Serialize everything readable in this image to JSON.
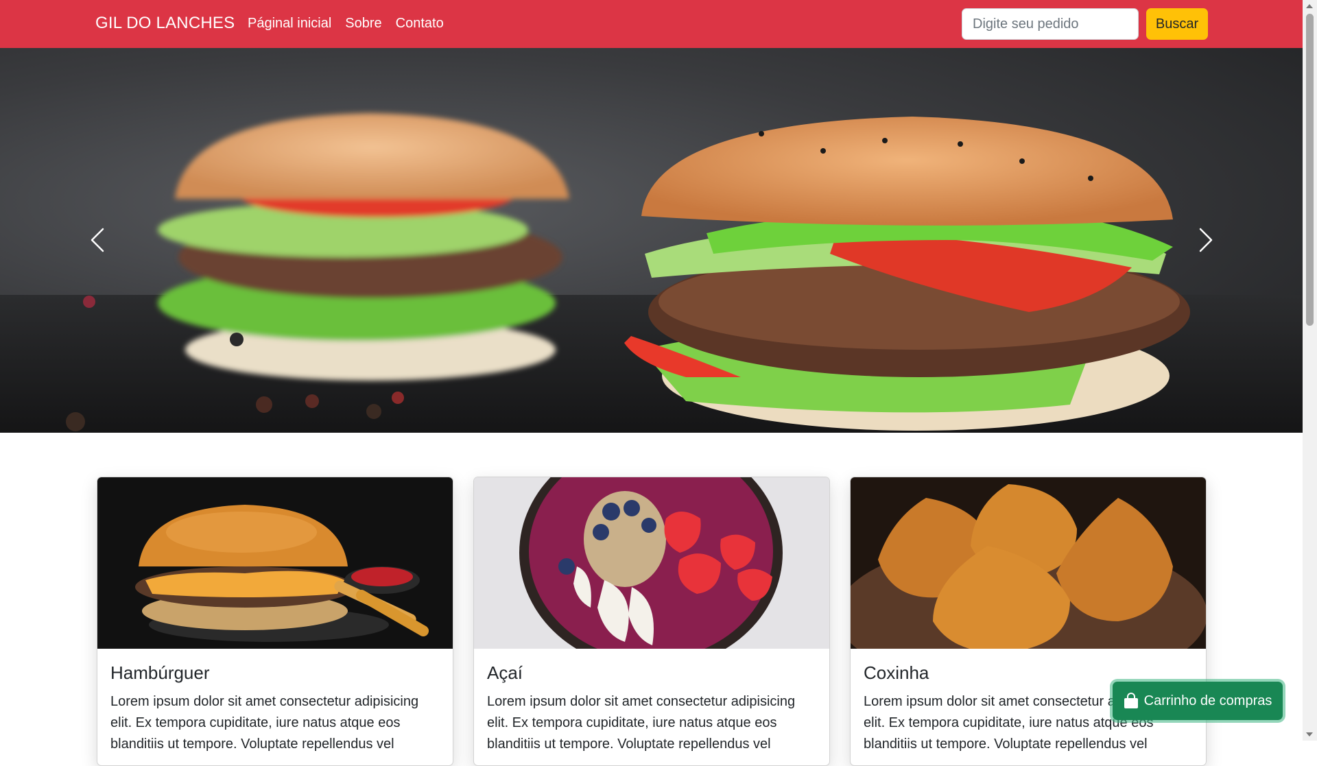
{
  "navbar": {
    "brand": "GIL DO LANCHES",
    "links": [
      "Páginal inicial",
      "Sobre",
      "Contato"
    ],
    "search_placeholder": "Digite seu pedido",
    "search_button": "Buscar",
    "background_color": "#dc3545",
    "button_color": "#ffc107"
  },
  "carousel": {
    "prev_icon": "chevron-left-icon",
    "next_icon": "chevron-right-icon"
  },
  "cards": [
    {
      "title": "Hambúrguer",
      "text": "Lorem ipsum dolor sit amet consectetur adipisicing elit. Ex tempora cupiditate, iure natus atque eos blanditiis ut tempore. Voluptate repellendus vel"
    },
    {
      "title": "Açaí",
      "text": "Lorem ipsum dolor sit amet consectetur adipisicing elit. Ex tempora cupiditate, iure natus atque eos blanditiis ut tempore. Voluptate repellendus vel"
    },
    {
      "title": "Coxinha",
      "text": "Lorem ipsum dolor sit amet consectetur adipisicing elit. Ex tempora cupiditate, iure natus atque eos blanditiis ut tempore. Voluptate repellendus vel"
    }
  ],
  "cart": {
    "label": "Carrinho de compras",
    "icon": "shopping-bag-icon",
    "color": "#198754"
  }
}
